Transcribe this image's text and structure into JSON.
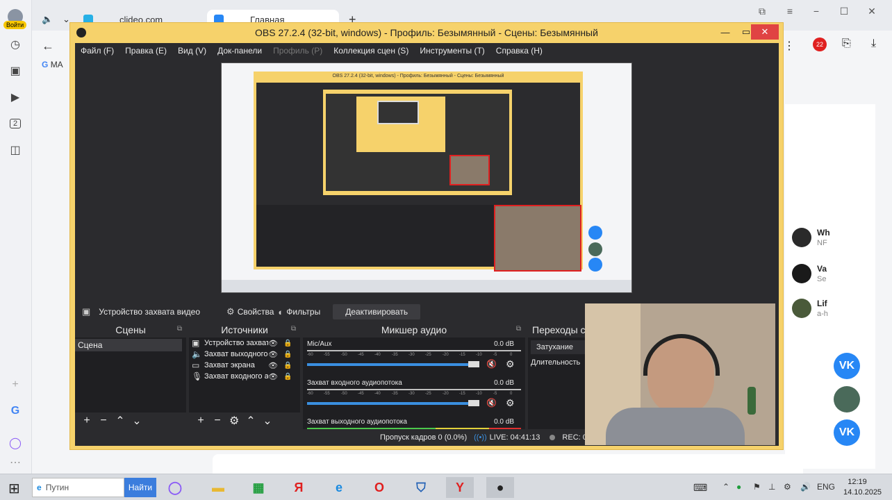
{
  "browser": {
    "login_label": "Войти",
    "tabs": [
      {
        "label": "clideo.com"
      },
      {
        "label": "Главная"
      }
    ],
    "new_tab": "+",
    "gmail_label": "MA",
    "sidebar_number": "2",
    "notif_badge": "22",
    "right_panel": [
      {
        "title": "Wh",
        "sub": "NF"
      },
      {
        "title": "Va",
        "sub": "Se"
      },
      {
        "title": "Lif",
        "sub": "a-h"
      }
    ],
    "vk_label": "VK"
  },
  "obs": {
    "title": "OBS 27.2.4 (32-bit, windows) - Профиль: Безымянный - Сцены: Безымянный",
    "menu": [
      {
        "label": "Файл (F)",
        "disabled": false
      },
      {
        "label": "Правка (E)",
        "disabled": false
      },
      {
        "label": "Вид (V)",
        "disabled": false
      },
      {
        "label": "Док-панели",
        "disabled": false
      },
      {
        "label": "Профиль (P)",
        "disabled": true
      },
      {
        "label": "Коллекция сцен (S)",
        "disabled": false
      },
      {
        "label": "Инструменты (T)",
        "disabled": false
      },
      {
        "label": "Справка (H)",
        "disabled": false
      }
    ],
    "toolbar": {
      "source_name": "Устройство захвата видео",
      "properties": "Свойства",
      "filters": "Фильтры",
      "deactivate": "Деактивировать"
    },
    "scenes": {
      "header": "Сцены",
      "items": [
        "Сцена"
      ]
    },
    "sources": {
      "header": "Источники",
      "items": [
        {
          "icon": "camera",
          "name": "Устройство захват"
        },
        {
          "icon": "speaker",
          "name": "Захват выходного"
        },
        {
          "icon": "monitor",
          "name": "Захват экрана"
        },
        {
          "icon": "mic",
          "name": "Захват входного а"
        }
      ]
    },
    "mixer": {
      "header": "Микшер аудио",
      "channels": [
        {
          "name": "Mic/Aux",
          "db": "0.0 dB"
        },
        {
          "name": "Захват входного аудиопотока",
          "db": "0.0 dB"
        },
        {
          "name": "Захват выходного аудиопотока",
          "db": "0.0 dB"
        }
      ],
      "scale": [
        "-60",
        "-55",
        "-50",
        "-45",
        "-40",
        "-35",
        "-30",
        "-25",
        "-20",
        "-15",
        "-10",
        "-5",
        "0"
      ]
    },
    "transitions": {
      "header": "Переходы с",
      "fade": "Затухание",
      "duration": "Длительность"
    },
    "status": {
      "dropped": "Пропуск кадров 0 (0.0%)",
      "live": "LIVE: 04:41:13",
      "rec": "REC: 00"
    },
    "recursive_title": "OBS 27.2.4 (32-bit, windows) - Профиль: Безымянный - Сцены: Безымянный"
  },
  "taskbar": {
    "search_value": "Путин",
    "search_button": "Найти",
    "language": "ENG",
    "time": "12:19",
    "date": "14.10.2025",
    "apps": [
      {
        "name": "alice",
        "glyph": "◯",
        "color": "#8b5cf6"
      },
      {
        "name": "explorer",
        "glyph": "▬",
        "color": "#e8b833"
      },
      {
        "name": "store",
        "glyph": "▦",
        "color": "#1f9d3c"
      },
      {
        "name": "yandex",
        "glyph": "Я",
        "color": "#e02020"
      },
      {
        "name": "edge",
        "glyph": "e",
        "color": "#1a8ae0"
      },
      {
        "name": "opera",
        "glyph": "O",
        "color": "#e01e1e"
      },
      {
        "name": "defender",
        "glyph": "⛉",
        "color": "#1f5fb4"
      },
      {
        "name": "yandex-browser",
        "glyph": "Y",
        "color": "#e02020"
      },
      {
        "name": "obs",
        "glyph": "●",
        "color": "#222"
      }
    ]
  },
  "colors": {
    "obs_frame": "#f6d26b",
    "obs_dark": "#2b2b2e",
    "close_red": "#e04343",
    "selection_red": "#e02020",
    "vk_blue": "#2787f5"
  }
}
